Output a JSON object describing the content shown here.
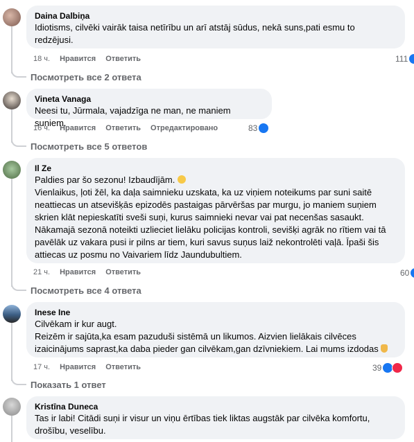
{
  "comments": [
    {
      "author": "Daina Dalbiņa",
      "lines": [
        "Idiotisms, cilvēki vairāk taisa netīrību un arī atstāj sūdus, nekā suns,pati esmu to",
        "redzējusi."
      ],
      "time": "18 ч.",
      "like": "Нравится",
      "reply": "Ответить",
      "edited": "",
      "count": "111",
      "view_replies": "Посмотреть все 2 ответа"
    },
    {
      "author": "Vineta Vanaga",
      "lines": [
        "Neesi tu, Jūrmala, vajadzīga ne man, ne maniem suņiem."
      ],
      "time": "16 ч.",
      "like": "Нравится",
      "reply": "Ответить",
      "edited": "Отредактировано",
      "count": "83",
      "view_replies": "Посмотреть все 5 ответов"
    },
    {
      "author": "Il Ze",
      "lines": [
        "Paldies par šo sezonu! Izbaudījām.",
        "Vienlaikus, ļoti žēl, ka daļa saimnieku uzskata, ka uz viņiem noteikums par suni saitē",
        "neattiecas un atsevišķās epizodēs pastaigas pārvēršas par murgu, jo maniem suņiem",
        "skrien klāt nepieskatīti sveši suņi, kurus saimnieki nevar vai pat necenšas sasaukt.",
        "Nākamajā sezonā noteikti uzlieciet lielāku policijas kontroli, sevišķi agrāk no rītiem vai tā",
        "pavēlāk uz vakara pusi ir pilns ar tiem, kuri savus suņus laiž nekontrolēti vaļā. Īpaši šis",
        "attiecas uz posmu no Vaivariem līdz Jaundubultiem."
      ],
      "time": "21 ч.",
      "like": "Нравится",
      "reply": "Ответить",
      "edited": "",
      "count": "60",
      "view_replies": "Посмотреть все 4 ответа"
    },
    {
      "author": "Inese Ine",
      "lines": [
        "Cilvēkam ir kur augt.",
        "Reizēm ir sajūta,ka esam pazuduši sistēmā un likumos. Aizvien lielākais cilvēces",
        "izaicinājums saprast,ka daba pieder gan cilvēkam,gan dzīvniekiem. Lai mums izdodas"
      ],
      "time": "17 ч.",
      "like": "Нравится",
      "reply": "Ответить",
      "edited": "",
      "count": "39",
      "view_replies": "Показать 1 ответ"
    },
    {
      "author": "Kristīna Duneca",
      "lines": [
        "Tas ir labi! Citādi suņi ir visur un viņu ērtības tiek liktas augstāk par cilvēka komfortu,",
        "drošību, veselību."
      ]
    }
  ]
}
